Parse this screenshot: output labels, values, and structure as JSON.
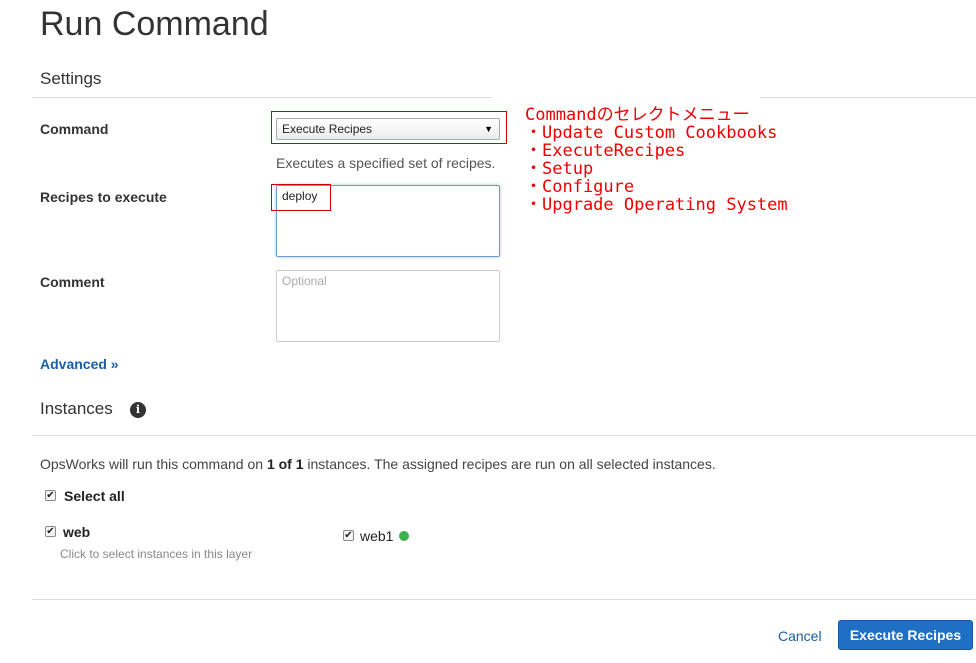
{
  "page": {
    "title": "Run Command"
  },
  "settings": {
    "section_title": "Settings",
    "command": {
      "label": "Command",
      "selected_value": "Execute Recipes",
      "help_text": "Executes a specified set of recipes."
    },
    "recipes": {
      "label": "Recipes to execute",
      "value": "deploy"
    },
    "comment": {
      "label": "Comment",
      "placeholder": "Optional"
    },
    "advanced_link": "Advanced »"
  },
  "annotation": {
    "lines": [
      "Commandのセレクトメニュー",
      "・Update Custom Cookbooks",
      "・ExecuteRecipes",
      "・Setup",
      "・Configure",
      "・Upgrade Operating System"
    ]
  },
  "instances": {
    "section_title": "Instances",
    "info_icon_glyph": "i",
    "description_prefix": "OpsWorks will run this command on ",
    "description_count": "1 of 1",
    "description_suffix": " instances. The assigned recipes are run on all selected instances.",
    "select_all_label": "Select all",
    "layer": {
      "name": "web",
      "hint": "Click to select instances in this layer"
    },
    "instance": {
      "name": "web1",
      "status_color": "#3cb44b"
    },
    "check_glyph": "✔"
  },
  "footer": {
    "cancel_label": "Cancel",
    "submit_label": "Execute Recipes"
  },
  "colors": {
    "link": "#1a5fa8",
    "primary_button": "#1f6fc5",
    "annotation": "#ee0000",
    "status_ok": "#3cb44b"
  }
}
